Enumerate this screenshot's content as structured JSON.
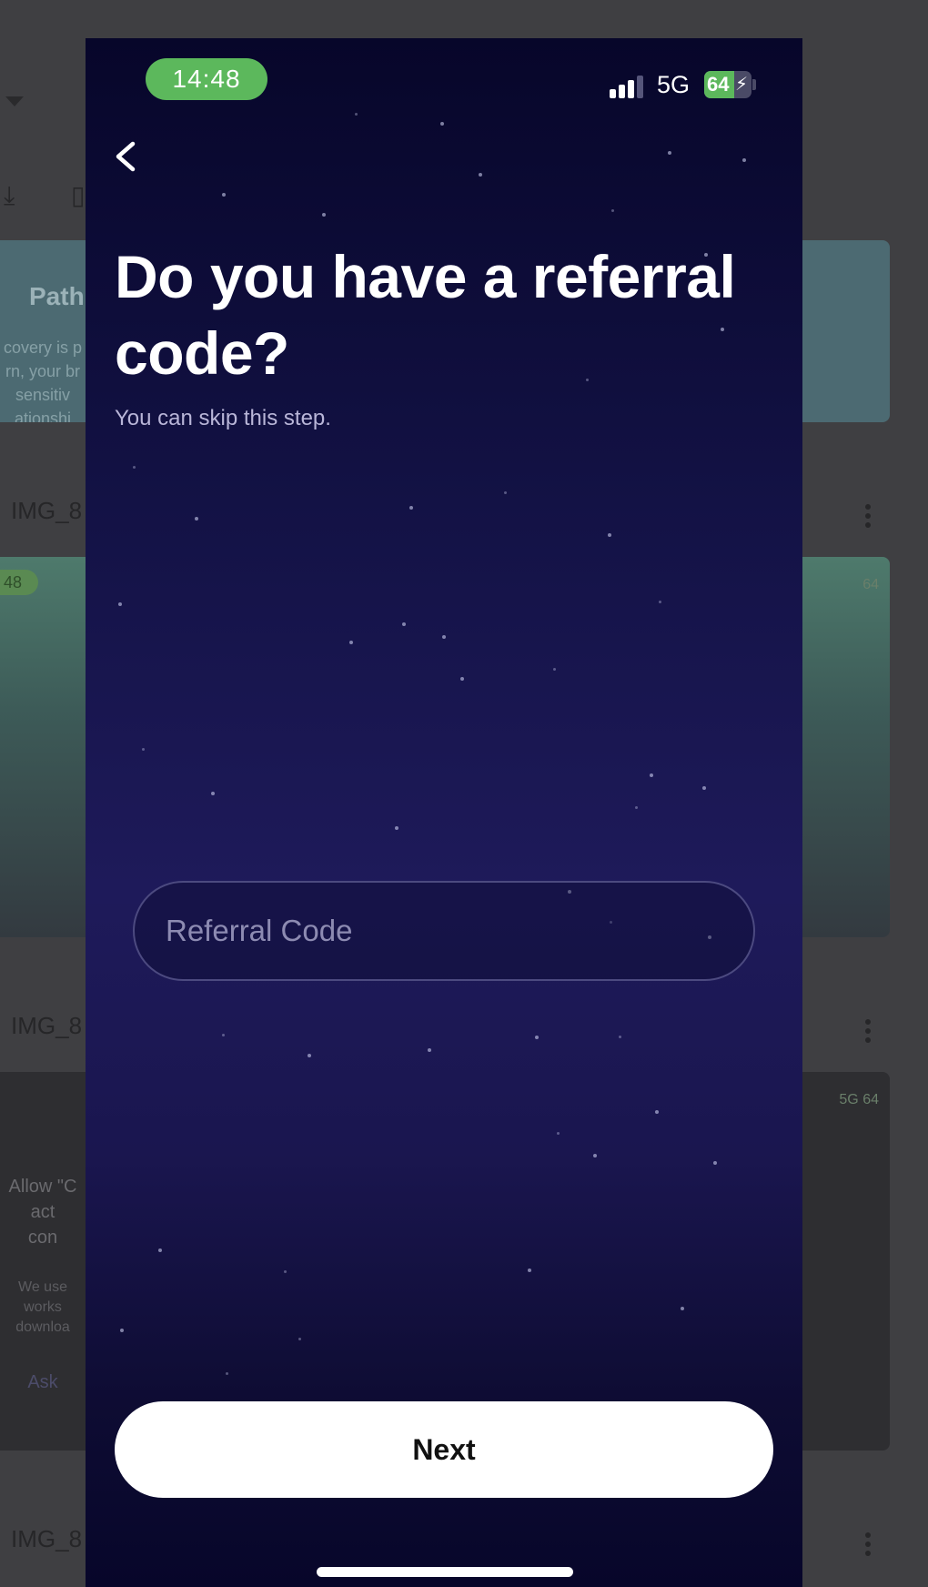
{
  "status_bar": {
    "time": "14:48",
    "network": "5G",
    "battery_percent": "64",
    "battery_level": 0.64,
    "battery_color": "#5cb85c",
    "signal_bars_active": 3,
    "signal_bars_total": 4
  },
  "screen": {
    "back_icon": "chevron-left-icon",
    "title": "Do you have a referral code?",
    "subtitle": "You can skip this step.",
    "referral_input": {
      "placeholder": "Referral Code",
      "value": ""
    },
    "next_button_label": "Next",
    "background_colors": [
      "#07062a",
      "#1e1a5a"
    ]
  },
  "background_app": {
    "card1_title_fragment": "Path",
    "card1_text_lines": [
      "covery is p",
      "rn, your br",
      "sensitiv",
      "ationshi"
    ],
    "list_items": [
      {
        "label": "IMG_8"
      },
      {
        "label": "IMG_8"
      },
      {
        "label": "IMG_8"
      }
    ],
    "screenshot_time_fragment": "48",
    "right_badge_1": "64",
    "right_badge_2": "5G 64",
    "dialog_lines": [
      "Allow \"C",
      "act",
      "con"
    ],
    "dialog_small_lines": [
      "We use",
      "works",
      "downloa"
    ],
    "dialog_button_fragment": "Ask"
  }
}
